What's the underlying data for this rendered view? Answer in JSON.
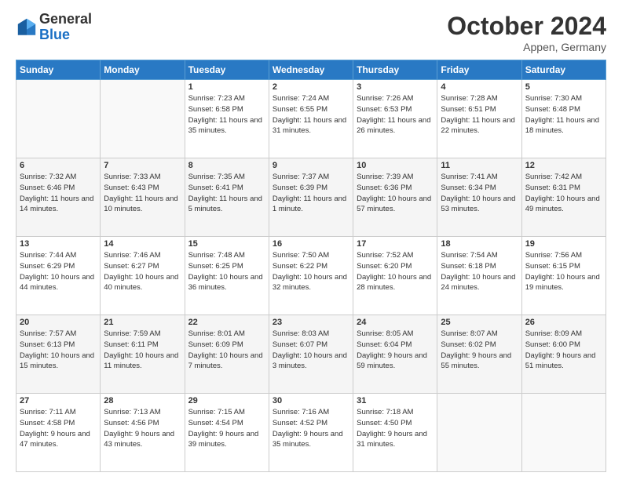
{
  "header": {
    "logo_general": "General",
    "logo_blue": "Blue",
    "month": "October 2024",
    "location": "Appen, Germany"
  },
  "weekdays": [
    "Sunday",
    "Monday",
    "Tuesday",
    "Wednesday",
    "Thursday",
    "Friday",
    "Saturday"
  ],
  "weeks": [
    [
      {
        "day": "",
        "sunrise": "",
        "sunset": "",
        "daylight": ""
      },
      {
        "day": "",
        "sunrise": "",
        "sunset": "",
        "daylight": ""
      },
      {
        "day": "1",
        "sunrise": "Sunrise: 7:23 AM",
        "sunset": "Sunset: 6:58 PM",
        "daylight": "Daylight: 11 hours and 35 minutes."
      },
      {
        "day": "2",
        "sunrise": "Sunrise: 7:24 AM",
        "sunset": "Sunset: 6:55 PM",
        "daylight": "Daylight: 11 hours and 31 minutes."
      },
      {
        "day": "3",
        "sunrise": "Sunrise: 7:26 AM",
        "sunset": "Sunset: 6:53 PM",
        "daylight": "Daylight: 11 hours and 26 minutes."
      },
      {
        "day": "4",
        "sunrise": "Sunrise: 7:28 AM",
        "sunset": "Sunset: 6:51 PM",
        "daylight": "Daylight: 11 hours and 22 minutes."
      },
      {
        "day": "5",
        "sunrise": "Sunrise: 7:30 AM",
        "sunset": "Sunset: 6:48 PM",
        "daylight": "Daylight: 11 hours and 18 minutes."
      }
    ],
    [
      {
        "day": "6",
        "sunrise": "Sunrise: 7:32 AM",
        "sunset": "Sunset: 6:46 PM",
        "daylight": "Daylight: 11 hours and 14 minutes."
      },
      {
        "day": "7",
        "sunrise": "Sunrise: 7:33 AM",
        "sunset": "Sunset: 6:43 PM",
        "daylight": "Daylight: 11 hours and 10 minutes."
      },
      {
        "day": "8",
        "sunrise": "Sunrise: 7:35 AM",
        "sunset": "Sunset: 6:41 PM",
        "daylight": "Daylight: 11 hours and 5 minutes."
      },
      {
        "day": "9",
        "sunrise": "Sunrise: 7:37 AM",
        "sunset": "Sunset: 6:39 PM",
        "daylight": "Daylight: 11 hours and 1 minute."
      },
      {
        "day": "10",
        "sunrise": "Sunrise: 7:39 AM",
        "sunset": "Sunset: 6:36 PM",
        "daylight": "Daylight: 10 hours and 57 minutes."
      },
      {
        "day": "11",
        "sunrise": "Sunrise: 7:41 AM",
        "sunset": "Sunset: 6:34 PM",
        "daylight": "Daylight: 10 hours and 53 minutes."
      },
      {
        "day": "12",
        "sunrise": "Sunrise: 7:42 AM",
        "sunset": "Sunset: 6:31 PM",
        "daylight": "Daylight: 10 hours and 49 minutes."
      }
    ],
    [
      {
        "day": "13",
        "sunrise": "Sunrise: 7:44 AM",
        "sunset": "Sunset: 6:29 PM",
        "daylight": "Daylight: 10 hours and 44 minutes."
      },
      {
        "day": "14",
        "sunrise": "Sunrise: 7:46 AM",
        "sunset": "Sunset: 6:27 PM",
        "daylight": "Daylight: 10 hours and 40 minutes."
      },
      {
        "day": "15",
        "sunrise": "Sunrise: 7:48 AM",
        "sunset": "Sunset: 6:25 PM",
        "daylight": "Daylight: 10 hours and 36 minutes."
      },
      {
        "day": "16",
        "sunrise": "Sunrise: 7:50 AM",
        "sunset": "Sunset: 6:22 PM",
        "daylight": "Daylight: 10 hours and 32 minutes."
      },
      {
        "day": "17",
        "sunrise": "Sunrise: 7:52 AM",
        "sunset": "Sunset: 6:20 PM",
        "daylight": "Daylight: 10 hours and 28 minutes."
      },
      {
        "day": "18",
        "sunrise": "Sunrise: 7:54 AM",
        "sunset": "Sunset: 6:18 PM",
        "daylight": "Daylight: 10 hours and 24 minutes."
      },
      {
        "day": "19",
        "sunrise": "Sunrise: 7:56 AM",
        "sunset": "Sunset: 6:15 PM",
        "daylight": "Daylight: 10 hours and 19 minutes."
      }
    ],
    [
      {
        "day": "20",
        "sunrise": "Sunrise: 7:57 AM",
        "sunset": "Sunset: 6:13 PM",
        "daylight": "Daylight: 10 hours and 15 minutes."
      },
      {
        "day": "21",
        "sunrise": "Sunrise: 7:59 AM",
        "sunset": "Sunset: 6:11 PM",
        "daylight": "Daylight: 10 hours and 11 minutes."
      },
      {
        "day": "22",
        "sunrise": "Sunrise: 8:01 AM",
        "sunset": "Sunset: 6:09 PM",
        "daylight": "Daylight: 10 hours and 7 minutes."
      },
      {
        "day": "23",
        "sunrise": "Sunrise: 8:03 AM",
        "sunset": "Sunset: 6:07 PM",
        "daylight": "Daylight: 10 hours and 3 minutes."
      },
      {
        "day": "24",
        "sunrise": "Sunrise: 8:05 AM",
        "sunset": "Sunset: 6:04 PM",
        "daylight": "Daylight: 9 hours and 59 minutes."
      },
      {
        "day": "25",
        "sunrise": "Sunrise: 8:07 AM",
        "sunset": "Sunset: 6:02 PM",
        "daylight": "Daylight: 9 hours and 55 minutes."
      },
      {
        "day": "26",
        "sunrise": "Sunrise: 8:09 AM",
        "sunset": "Sunset: 6:00 PM",
        "daylight": "Daylight: 9 hours and 51 minutes."
      }
    ],
    [
      {
        "day": "27",
        "sunrise": "Sunrise: 7:11 AM",
        "sunset": "Sunset: 4:58 PM",
        "daylight": "Daylight: 9 hours and 47 minutes."
      },
      {
        "day": "28",
        "sunrise": "Sunrise: 7:13 AM",
        "sunset": "Sunset: 4:56 PM",
        "daylight": "Daylight: 9 hours and 43 minutes."
      },
      {
        "day": "29",
        "sunrise": "Sunrise: 7:15 AM",
        "sunset": "Sunset: 4:54 PM",
        "daylight": "Daylight: 9 hours and 39 minutes."
      },
      {
        "day": "30",
        "sunrise": "Sunrise: 7:16 AM",
        "sunset": "Sunset: 4:52 PM",
        "daylight": "Daylight: 9 hours and 35 minutes."
      },
      {
        "day": "31",
        "sunrise": "Sunrise: 7:18 AM",
        "sunset": "Sunset: 4:50 PM",
        "daylight": "Daylight: 9 hours and 31 minutes."
      },
      {
        "day": "",
        "sunrise": "",
        "sunset": "",
        "daylight": ""
      },
      {
        "day": "",
        "sunrise": "",
        "sunset": "",
        "daylight": ""
      }
    ]
  ]
}
